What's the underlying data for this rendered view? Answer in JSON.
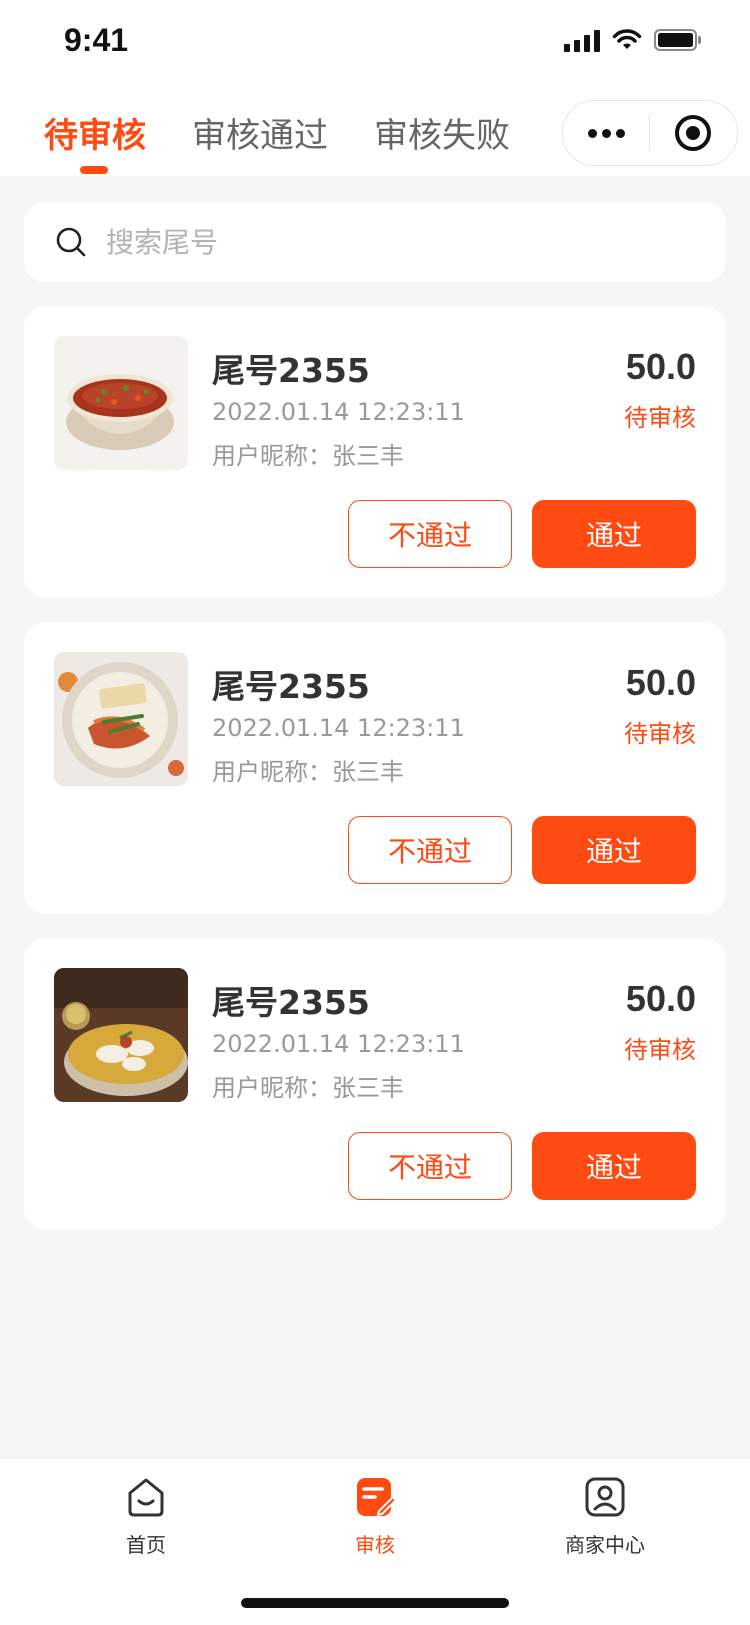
{
  "status_bar": {
    "time": "9:41"
  },
  "tabs": [
    {
      "label": "待审核",
      "active": true
    },
    {
      "label": "审核通过",
      "active": false
    },
    {
      "label": "审核失败",
      "active": false
    }
  ],
  "search": {
    "placeholder": "搜索尾号",
    "value": ""
  },
  "orders": [
    {
      "title": "尾号2355",
      "datetime": "2022.01.14 12:23:11",
      "nickname": "用户昵称：张三丰",
      "price": "50.0",
      "status": "待审核",
      "reject_label": "不通过",
      "approve_label": "通过",
      "image": "soup-dish"
    },
    {
      "title": "尾号2355",
      "datetime": "2022.01.14 12:23:11",
      "nickname": "用户昵称：张三丰",
      "price": "50.0",
      "status": "待审核",
      "reject_label": "不通过",
      "approve_label": "通过",
      "image": "pasta-dish"
    },
    {
      "title": "尾号2355",
      "datetime": "2022.01.14 12:23:11",
      "nickname": "用户昵称：张三丰",
      "price": "50.0",
      "status": "待审核",
      "reject_label": "不通过",
      "approve_label": "通过",
      "image": "fish-pot-dish"
    }
  ],
  "tabbar": [
    {
      "label": "首页",
      "icon": "home-icon",
      "active": false
    },
    {
      "label": "审核",
      "icon": "review-icon",
      "active": true
    },
    {
      "label": "商家中心",
      "icon": "merchant-icon",
      "active": false
    }
  ],
  "colors": {
    "accent": "#ff4a12",
    "background": "#f6f6f6"
  }
}
